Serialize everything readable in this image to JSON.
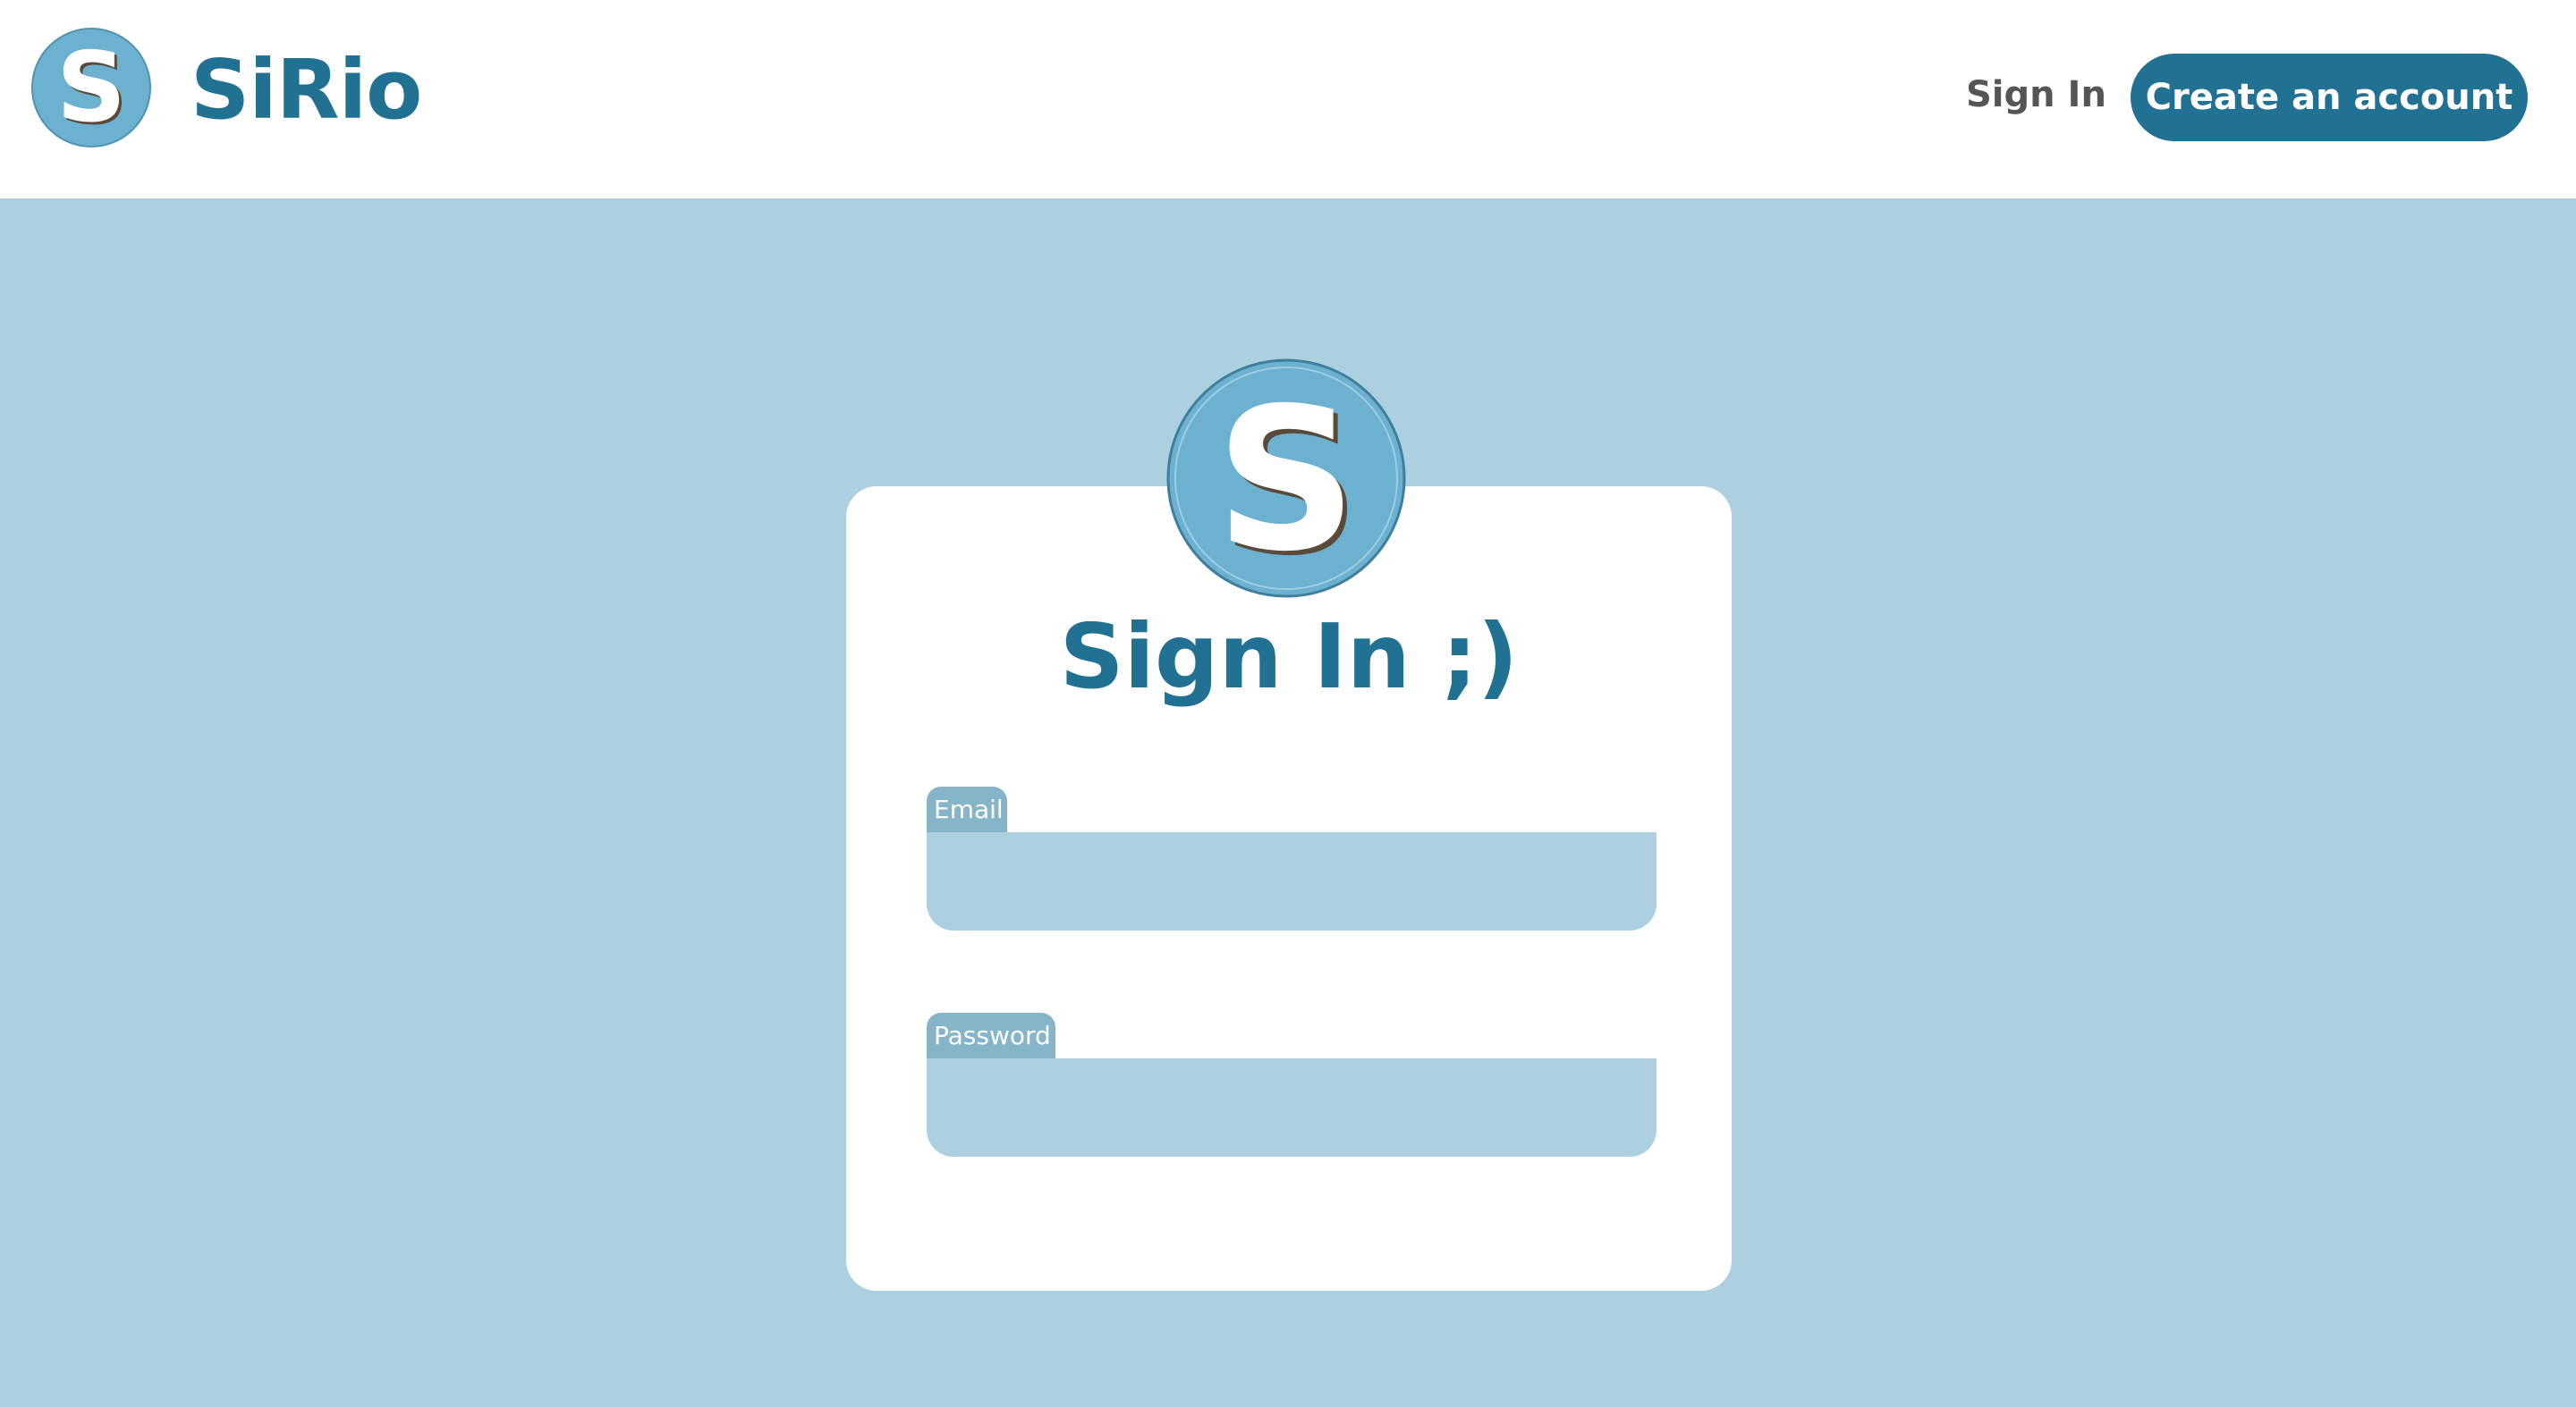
{
  "header": {
    "brand_name": "SiRio",
    "logo_letter": "S",
    "nav": {
      "sign_in": "Sign In",
      "create_account": "Create an account"
    }
  },
  "signin_card": {
    "logo_letter": "S",
    "title": "Sign In ;)",
    "fields": {
      "email": {
        "label": "Email",
        "value": ""
      },
      "password": {
        "label": "Password",
        "value": ""
      }
    }
  },
  "colors": {
    "brand": "#217193",
    "page_background": "#acd0e0",
    "logo_fill": "#6cb2d0",
    "field_tab": "#86b5c9",
    "nav_text": "#555555"
  }
}
